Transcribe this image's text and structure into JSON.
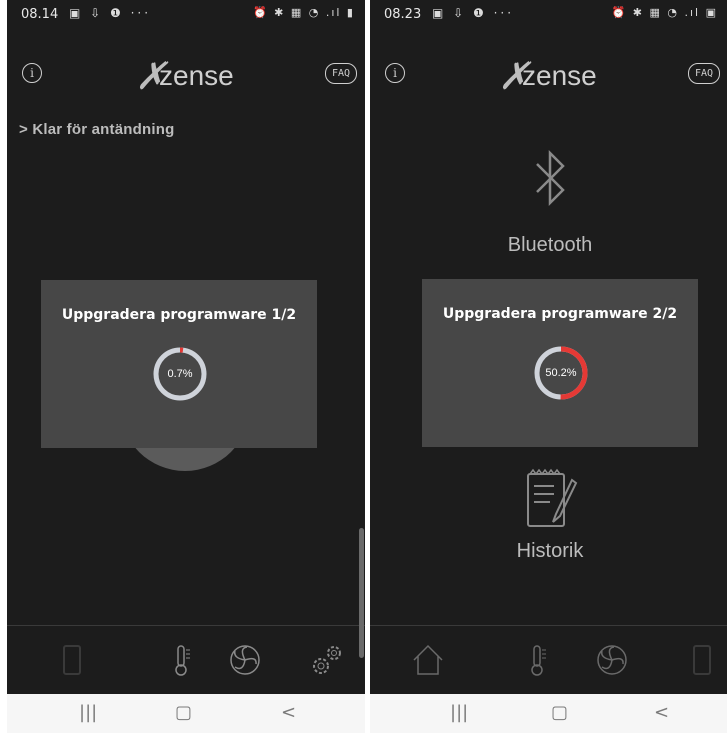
{
  "left": {
    "time": "08.14",
    "status_text": "Klar för antändning",
    "dialog_title": "Uppgradera programware 1/2",
    "progress_label": "0.7%",
    "progress": 0.007
  },
  "right": {
    "time": "08.23",
    "bluetooth_label": "Bluetooth",
    "history_label": "Historik",
    "dialog_title": "Uppgradera programware 2/2",
    "progress_label": "50.2%",
    "progress": 0.502
  },
  "common": {
    "logo_text": "zense",
    "faq_label": "FAQ",
    "info_label": "i",
    "nav_recent": "|||",
    "nav_home": "▢",
    "nav_back": "<"
  },
  "colors": {
    "screen_bg": "#1c1c1c",
    "dialog_bg": "#474747",
    "ring_track": "#cfd3da",
    "ring_progress": "#e53935"
  },
  "icons": {
    "nav": [
      "phone-icon",
      "thermometer-icon",
      "fan-icon",
      "settings-icon"
    ],
    "nav_right": [
      "home-icon",
      "thermometer-icon",
      "fan-icon",
      "phone-icon"
    ]
  }
}
